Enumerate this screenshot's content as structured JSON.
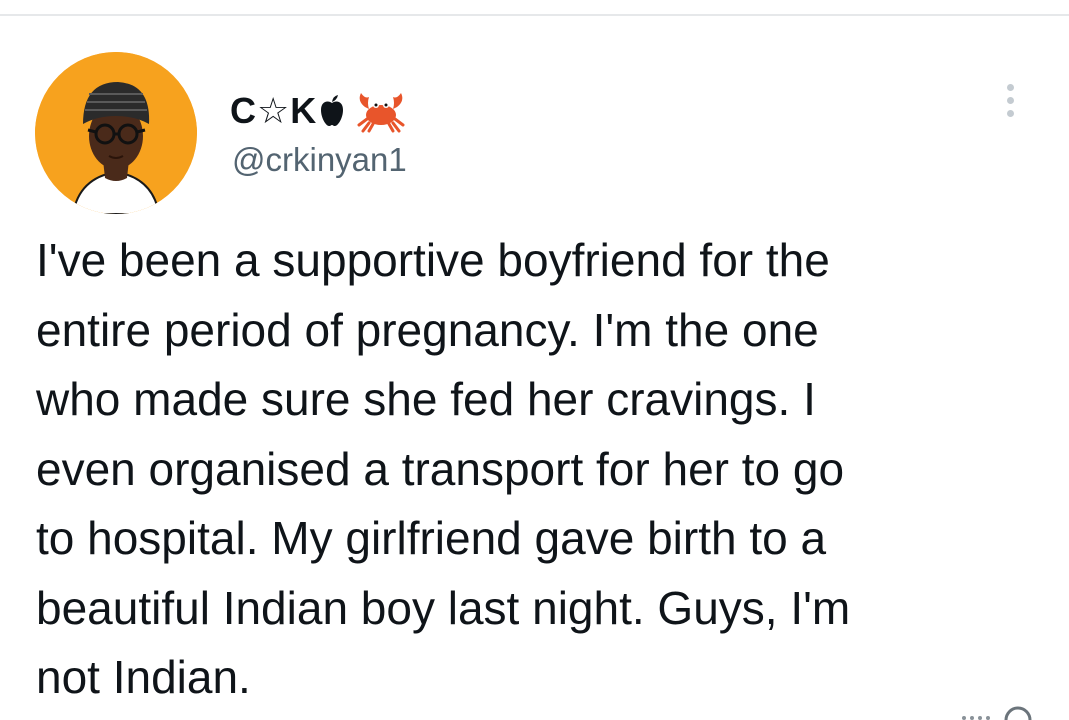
{
  "tweet": {
    "display_name": "C☆K",
    "handle": "@crkinyan1",
    "avatar_bg_color": "#f7a21e",
    "name_icons": [
      "apple-icon",
      "crab-icon"
    ],
    "text": "I've been a supportive boyfriend for the\nentire period of pregnancy. I'm the one\nwho made sure she fed her cravings. I\neven organised a transport for her to go\nto hospital. My girlfriend gave birth to a\nbeautiful Indian boy last night. Guys, I'm\nnot Indian.",
    "more_icon": "more-options-icon"
  },
  "colors": {
    "text": "#0f1419",
    "handle": "#536471",
    "crab": "#e8552b"
  }
}
